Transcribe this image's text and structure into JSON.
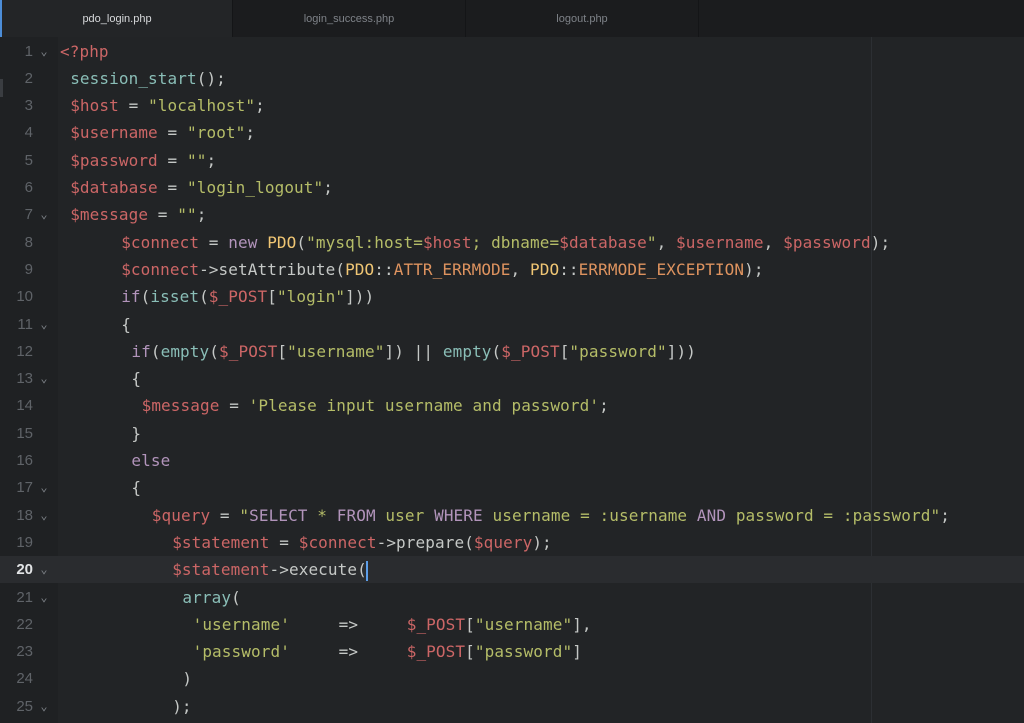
{
  "tabs": [
    {
      "label": "pdo_login.php",
      "active": true
    },
    {
      "label": "login_success.php",
      "active": false
    },
    {
      "label": "logout.php",
      "active": false
    }
  ],
  "editor": {
    "cursor_line": 20,
    "accent_color": "#4c8dd8",
    "lines": [
      {
        "n": "1",
        "fold": true,
        "indent": 0,
        "tokens": [
          [
            "tag",
            "<?php"
          ]
        ]
      },
      {
        "n": "2",
        "fold": false,
        "indent": 1,
        "tokens": [
          [
            "fn",
            "session_start"
          ],
          [
            "plain",
            "();"
          ]
        ]
      },
      {
        "n": "3",
        "fold": false,
        "indent": 1,
        "tokens": [
          [
            "var",
            "$host"
          ],
          [
            "plain",
            " = "
          ],
          [
            "str",
            "\"localhost\""
          ],
          [
            "plain",
            ";"
          ]
        ]
      },
      {
        "n": "4",
        "fold": false,
        "indent": 1,
        "tokens": [
          [
            "var",
            "$username"
          ],
          [
            "plain",
            " = "
          ],
          [
            "str",
            "\"root\""
          ],
          [
            "plain",
            ";"
          ]
        ]
      },
      {
        "n": "5",
        "fold": false,
        "indent": 1,
        "tokens": [
          [
            "var",
            "$password"
          ],
          [
            "plain",
            " = "
          ],
          [
            "str",
            "\"\""
          ],
          [
            "plain",
            ";"
          ]
        ]
      },
      {
        "n": "6",
        "fold": false,
        "indent": 1,
        "tokens": [
          [
            "var",
            "$database"
          ],
          [
            "plain",
            " = "
          ],
          [
            "str",
            "\"login_logout\""
          ],
          [
            "plain",
            ";"
          ]
        ]
      },
      {
        "n": "7",
        "fold": true,
        "indent": 1,
        "tokens": [
          [
            "var",
            "$message"
          ],
          [
            "plain",
            " = "
          ],
          [
            "str",
            "\"\""
          ],
          [
            "plain",
            ";"
          ]
        ]
      },
      {
        "n": "8",
        "fold": false,
        "indent": 6,
        "tokens": [
          [
            "var",
            "$connect"
          ],
          [
            "plain",
            " = "
          ],
          [
            "kw",
            "new"
          ],
          [
            "plain",
            " "
          ],
          [
            "cls",
            "PDO"
          ],
          [
            "plain",
            "("
          ],
          [
            "str",
            "\"mysql:host="
          ],
          [
            "var",
            "$host"
          ],
          [
            "str",
            "; dbname="
          ],
          [
            "var",
            "$database"
          ],
          [
            "str",
            "\""
          ],
          [
            "plain",
            ", "
          ],
          [
            "var",
            "$username"
          ],
          [
            "plain",
            ", "
          ],
          [
            "var",
            "$password"
          ],
          [
            "plain",
            ");"
          ]
        ]
      },
      {
        "n": "9",
        "fold": false,
        "indent": 6,
        "tokens": [
          [
            "var",
            "$connect"
          ],
          [
            "plain",
            "->setAttribute("
          ],
          [
            "cls",
            "PDO"
          ],
          [
            "plain",
            "::"
          ],
          [
            "const",
            "ATTR_ERRMODE"
          ],
          [
            "plain",
            ", "
          ],
          [
            "cls",
            "PDO"
          ],
          [
            "plain",
            "::"
          ],
          [
            "const",
            "ERRMODE_EXCEPTION"
          ],
          [
            "plain",
            ");"
          ]
        ]
      },
      {
        "n": "10",
        "fold": false,
        "indent": 6,
        "tokens": [
          [
            "kw",
            "if"
          ],
          [
            "plain",
            "("
          ],
          [
            "fn",
            "isset"
          ],
          [
            "plain",
            "("
          ],
          [
            "var",
            "$_POST"
          ],
          [
            "plain",
            "["
          ],
          [
            "str",
            "\"login\""
          ],
          [
            "plain",
            "]))"
          ]
        ]
      },
      {
        "n": "11",
        "fold": true,
        "indent": 6,
        "tokens": [
          [
            "plain",
            "{"
          ]
        ]
      },
      {
        "n": "12",
        "fold": false,
        "indent": 7,
        "tokens": [
          [
            "kw",
            "if"
          ],
          [
            "plain",
            "("
          ],
          [
            "fn",
            "empty"
          ],
          [
            "plain",
            "("
          ],
          [
            "var",
            "$_POST"
          ],
          [
            "plain",
            "["
          ],
          [
            "str",
            "\"username\""
          ],
          [
            "plain",
            "]) || "
          ],
          [
            "fn",
            "empty"
          ],
          [
            "plain",
            "("
          ],
          [
            "var",
            "$_POST"
          ],
          [
            "plain",
            "["
          ],
          [
            "str",
            "\"password\""
          ],
          [
            "plain",
            "]))"
          ]
        ]
      },
      {
        "n": "13",
        "fold": true,
        "indent": 7,
        "tokens": [
          [
            "plain",
            "{"
          ]
        ]
      },
      {
        "n": "14",
        "fold": false,
        "indent": 8,
        "tokens": [
          [
            "var",
            "$message"
          ],
          [
            "plain",
            " = "
          ],
          [
            "str",
            "'Please input username and password'"
          ],
          [
            "plain",
            ";"
          ]
        ]
      },
      {
        "n": "15",
        "fold": false,
        "indent": 7,
        "tokens": [
          [
            "plain",
            "}"
          ]
        ]
      },
      {
        "n": "16",
        "fold": false,
        "indent": 7,
        "tokens": [
          [
            "kw",
            "else"
          ]
        ]
      },
      {
        "n": "17",
        "fold": true,
        "indent": 7,
        "tokens": [
          [
            "plain",
            "{"
          ]
        ]
      },
      {
        "n": "18",
        "fold": true,
        "indent": 9,
        "tokens": [
          [
            "var",
            "$query"
          ],
          [
            "plain",
            " = "
          ],
          [
            "str",
            "\""
          ],
          [
            "kw",
            "SELECT"
          ],
          [
            "str",
            " * "
          ],
          [
            "kw",
            "FROM"
          ],
          [
            "str",
            " user "
          ],
          [
            "kw",
            "WHERE"
          ],
          [
            "str",
            " username = :username "
          ],
          [
            "kw",
            "AND"
          ],
          [
            "str",
            " password = :password\""
          ],
          [
            "plain",
            ";"
          ]
        ]
      },
      {
        "n": "19",
        "fold": false,
        "indent": 11,
        "tokens": [
          [
            "var",
            "$statement"
          ],
          [
            "plain",
            " = "
          ],
          [
            "var",
            "$connect"
          ],
          [
            "plain",
            "->prepare("
          ],
          [
            "var",
            "$query"
          ],
          [
            "plain",
            ");"
          ]
        ]
      },
      {
        "n": "20",
        "fold": true,
        "indent": 11,
        "tokens": [
          [
            "var",
            "$statement"
          ],
          [
            "plain",
            "->execute("
          ]
        ]
      },
      {
        "n": "21",
        "fold": true,
        "indent": 12,
        "tokens": [
          [
            "fn",
            "array"
          ],
          [
            "plain",
            "("
          ]
        ]
      },
      {
        "n": "22",
        "fold": false,
        "indent": 13,
        "tokens": [
          [
            "str",
            "'username'"
          ],
          [
            "plain",
            "     =>     "
          ],
          [
            "var",
            "$_POST"
          ],
          [
            "plain",
            "["
          ],
          [
            "str",
            "\"username\""
          ],
          [
            "plain",
            "],"
          ]
        ]
      },
      {
        "n": "23",
        "fold": false,
        "indent": 13,
        "tokens": [
          [
            "str",
            "'password'"
          ],
          [
            "plain",
            "     =>     "
          ],
          [
            "var",
            "$_POST"
          ],
          [
            "plain",
            "["
          ],
          [
            "str",
            "\"password\""
          ],
          [
            "plain",
            "]"
          ]
        ]
      },
      {
        "n": "24",
        "fold": false,
        "indent": 12,
        "tokens": [
          [
            "plain",
            ")"
          ]
        ]
      },
      {
        "n": "25",
        "fold": true,
        "indent": 11,
        "tokens": [
          [
            "plain",
            ");"
          ]
        ]
      }
    ]
  }
}
